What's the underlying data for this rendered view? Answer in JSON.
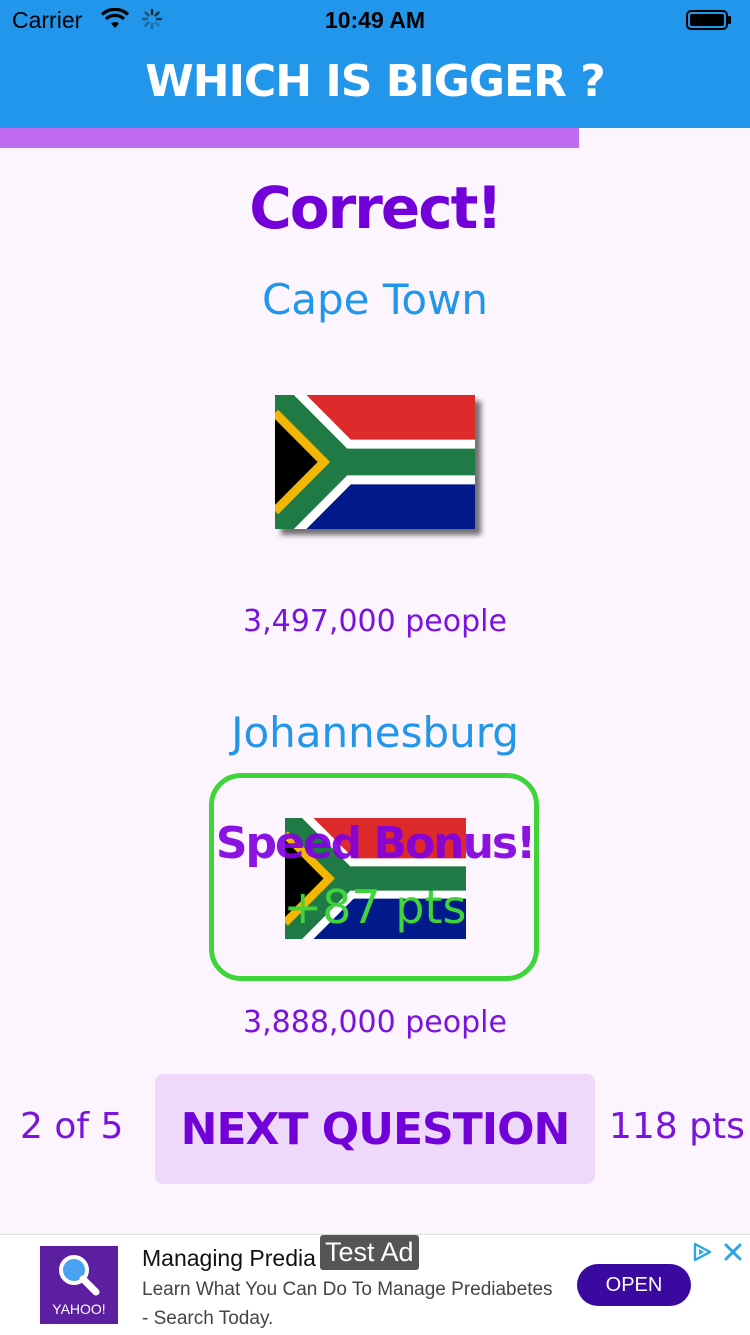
{
  "status_bar": {
    "carrier": "Carrier",
    "time": "10:49 AM"
  },
  "header": {
    "title": "WHICH IS BIGGER ?"
  },
  "progress": {
    "fraction": 0.772,
    "color": "#c06cf0"
  },
  "result": {
    "text": "Correct!"
  },
  "option_a": {
    "city": "Cape Town",
    "population": "3,497,000 people",
    "flag_icon": "south-africa-flag-icon"
  },
  "option_b": {
    "city": "Johannesburg",
    "population": "3,888,000 people",
    "flag_icon": "south-africa-flag-icon",
    "selected_border_color": "#3fd43a",
    "bonus_title": "Speed Bonus!",
    "bonus_points": "+87 pts"
  },
  "footer": {
    "counter": "2 of 5",
    "next_label": "NEXT QUESTION",
    "score": "118 pts"
  },
  "ad": {
    "logo_text": "YAHOO!",
    "headline": "Managing Predia",
    "test_label": "Test Ad",
    "body": "Learn What You Can Do To Manage Prediabetes - Search Today.",
    "cta": "OPEN"
  },
  "colors": {
    "header_blue": "#2196ea",
    "accent_purple": "#7200d8",
    "background": "#fdf5fd"
  }
}
